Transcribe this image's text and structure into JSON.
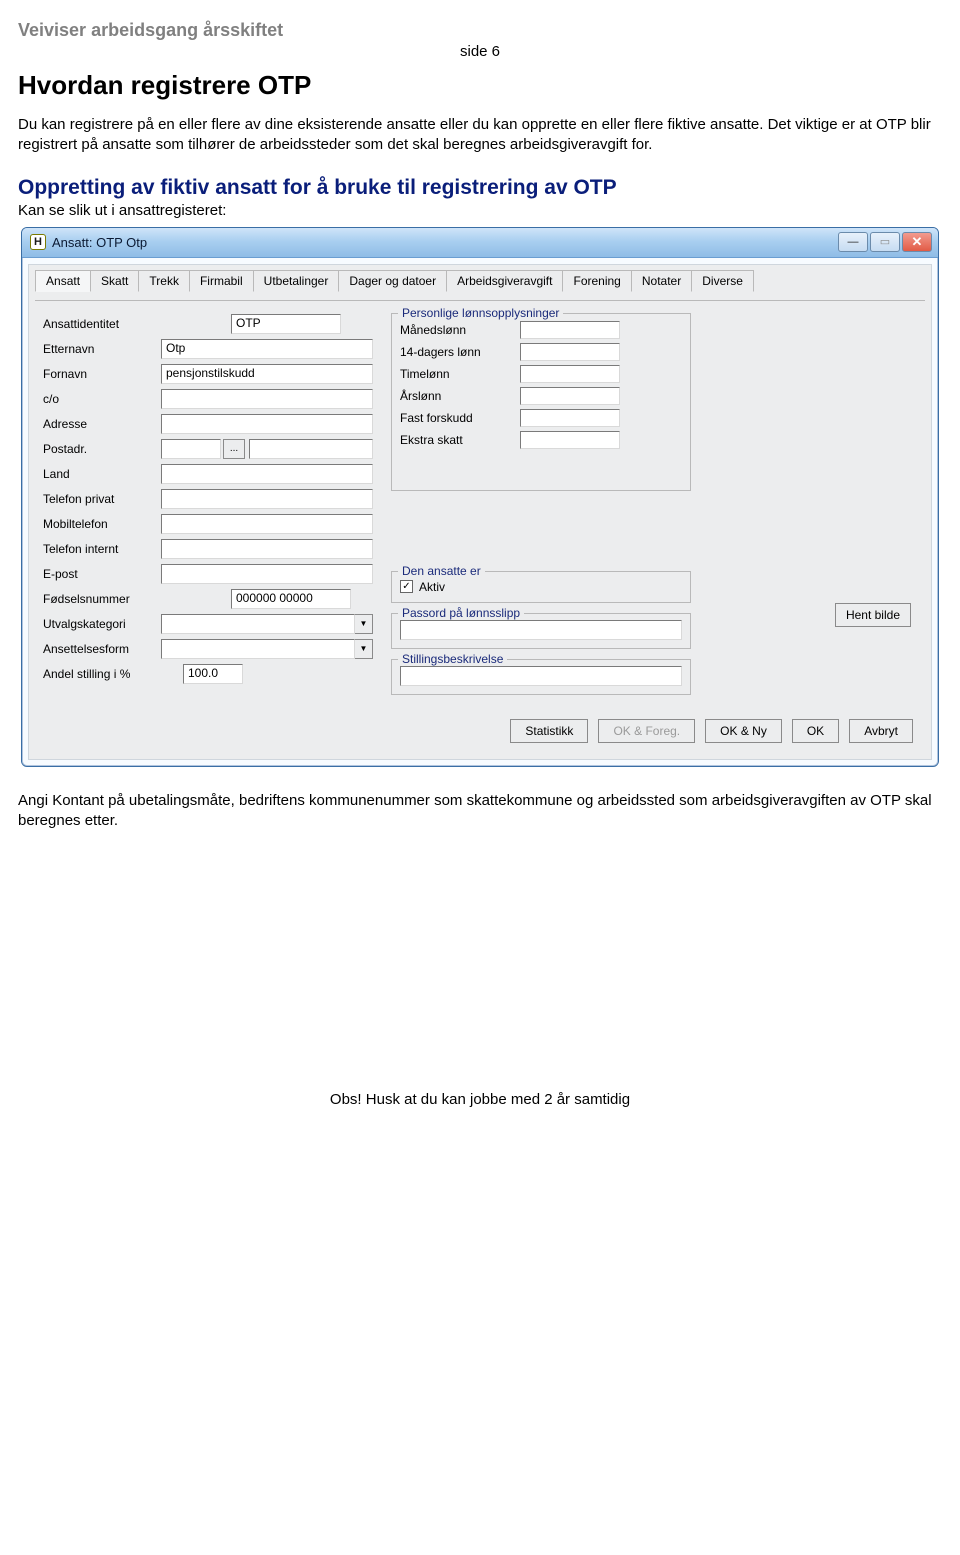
{
  "doc": {
    "header": "Veiviser arbeidsgang årsskiftet",
    "page_label": "side 6",
    "title": "Hvordan registrere OTP",
    "para1": "Du kan registrere på en eller flere av dine eksisterende ansatte eller du kan opprette en eller flere fiktive ansatte. Det viktige er at OTP blir registrert på ansatte som tilhører de arbeidssteder som det skal beregnes arbeidsgiveravgift for.",
    "subtitle": "Oppretting av fiktiv ansatt for å bruke til registrering av OTP",
    "subcaption": "Kan se slik ut i ansattregisteret:",
    "para2": "Angi Kontant på ubetalingsmåte, bedriftens kommunenummer som skattekommune og arbeidssted som arbeidsgiveravgiften av OTP skal beregnes etter.",
    "footer": "Obs! Husk at du kan jobbe med 2 år samtidig"
  },
  "window": {
    "title": "Ansatt: OTP Otp",
    "icon_letter": "H"
  },
  "tabs": [
    "Ansatt",
    "Skatt",
    "Trekk",
    "Firmabil",
    "Utbetalinger",
    "Dager og datoer",
    "Arbeidsgiveravgift",
    "Forening",
    "Notater",
    "Diverse"
  ],
  "left": {
    "labels": {
      "ansattid": "Ansattidentitet",
      "etternavn": "Etternavn",
      "fornavn": "Fornavn",
      "co": "c/o",
      "adresse": "Adresse",
      "postadr": "Postadr.",
      "land": "Land",
      "tlfpriv": "Telefon privat",
      "mobil": "Mobiltelefon",
      "tlfint": "Telefon internt",
      "epost": "E-post",
      "fnr": "Fødselsnummer",
      "utvalg": "Utvalgskategori",
      "ansform": "Ansettelsesform",
      "andel": "Andel stilling i %"
    },
    "values": {
      "ansattid": "OTP",
      "etternavn": "Otp",
      "fornavn": "pensjonstilskudd",
      "co": "",
      "adresse": "",
      "postadr": "",
      "land": "",
      "tlfpriv": "",
      "mobil": "",
      "tlfint": "",
      "epost": "",
      "fnr": "000000 00000",
      "utvalg": "",
      "ansform": "",
      "andel": "100.0"
    },
    "browse": "..."
  },
  "mid": {
    "group_pay": "Personlige lønnsopplysninger",
    "pay_labels": {
      "maned": "Månedslønn",
      "d14": "14-dagers lønn",
      "time": "Timelønn",
      "aar": "Årslønn",
      "forskudd": "Fast forskudd",
      "ekstra": "Ekstra skatt"
    },
    "group_ansatt": "Den ansatte er",
    "aktiv_label": "Aktiv",
    "aktiv_checked": true,
    "group_passord": "Passord på lønnsslipp",
    "group_stilling": "Stillingsbeskrivelse"
  },
  "right": {
    "hent_bilde": "Hent bilde"
  },
  "buttons": {
    "statistikk": "Statistikk",
    "okforeg": "OK & Foreg.",
    "okny": "OK & Ny",
    "ok": "OK",
    "avbryt": "Avbryt"
  }
}
